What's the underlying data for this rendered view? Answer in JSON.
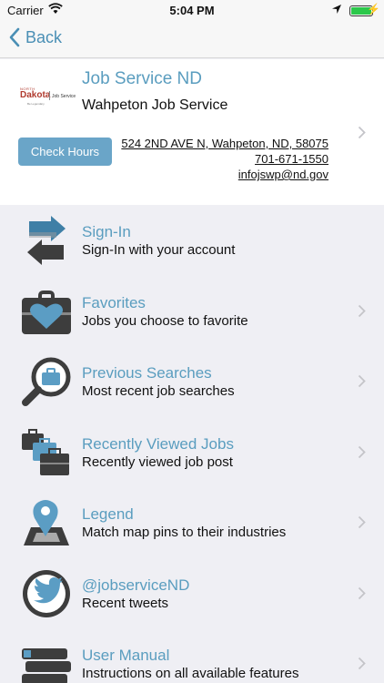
{
  "status_bar": {
    "carrier": "Carrier",
    "time": "5:04 PM"
  },
  "nav": {
    "back_label": "Back"
  },
  "office": {
    "logo": {
      "small_text": "NORTH",
      "name": "Dakota",
      "service": "Job Service",
      "tagline": "Be Legendary."
    },
    "title": "Job Service ND",
    "subtitle": "Wahpeton Job Service",
    "check_hours_label": "Check Hours",
    "address": "524 2ND AVE N, Wahpeton, ND, 58075",
    "phone": "701-671-1550",
    "email": "infojswp@nd.gov"
  },
  "menu": [
    {
      "title": "Sign-In",
      "subtitle": "Sign-In with your account",
      "icon": "sign-in-arrows-icon"
    },
    {
      "title": "Favorites",
      "subtitle": "Jobs you choose to favorite",
      "icon": "briefcase-heart-icon"
    },
    {
      "title": "Previous Searches",
      "subtitle": "Most recent job searches",
      "icon": "magnifier-briefcase-icon"
    },
    {
      "title": "Recently Viewed Jobs",
      "subtitle": "Recently viewed job post",
      "icon": "briefcase-stack-icon"
    },
    {
      "title": "Legend",
      "subtitle": "Match map pins to their industries",
      "icon": "map-pin-icon"
    },
    {
      "title": "@jobserviceND",
      "subtitle": "Recent tweets",
      "icon": "twitter-bird-icon"
    },
    {
      "title": "User Manual",
      "subtitle": "Instructions on all available features",
      "icon": "books-icon"
    }
  ],
  "colors": {
    "accent": "#5a9dbf",
    "button": "#6aa5c8",
    "battery": "#2cc84b"
  }
}
